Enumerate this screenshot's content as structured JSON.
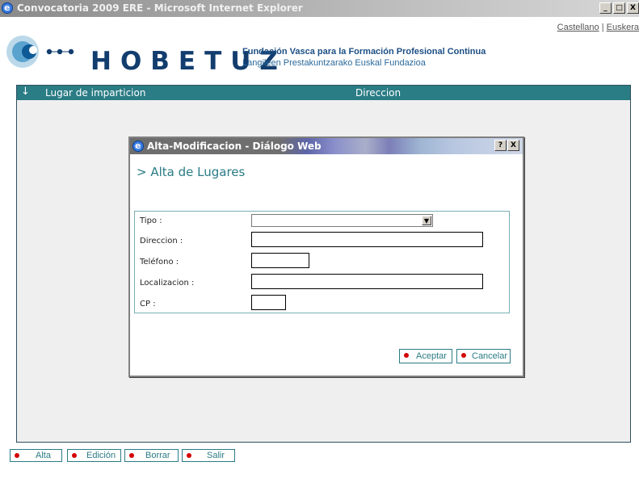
{
  "window": {
    "title": "Convocatoria 2009 ERE - Microsoft Internet Explorer",
    "minimize": "_",
    "maximize": "□",
    "close": "X"
  },
  "header": {
    "lang_castellano": "Castellano",
    "lang_sep": " | ",
    "lang_euskera": "Euskera",
    "brand": "HOBETUZ",
    "tagline_es": "Fundación Vasca para la Formación Profesional Continua",
    "tagline_eu": "Langileen Prestakuntzarako Euskal Fundazioa"
  },
  "panel": {
    "arrow_icon": "↓",
    "col_lugar": "Lugar de imparticion",
    "col_direccion": "Direccion"
  },
  "dialog": {
    "title": "Alta-Modificacion - Diálogo Web",
    "help": "?",
    "close": "X",
    "heading": "> Alta de Lugares",
    "fields": {
      "tipo_label": "Tipo :",
      "tipo_value": "",
      "direccion_label": "Direccion :",
      "direccion_value": "",
      "telefono_label": "Teléfono :",
      "telefono_value": "",
      "localizacion_label": "Localizacion :",
      "localizacion_value": "",
      "cp_label": "CP :",
      "cp_value": ""
    },
    "aceptar": "Aceptar",
    "cancelar": "Cancelar"
  },
  "bottom_buttons": {
    "alta": "Alta",
    "edicion": "Edición",
    "borrar": "Borrar",
    "salir": "Salir"
  },
  "colors": {
    "teal": "#2a7c85",
    "navy": "#123d6e",
    "bullet_red": "#d40000"
  }
}
